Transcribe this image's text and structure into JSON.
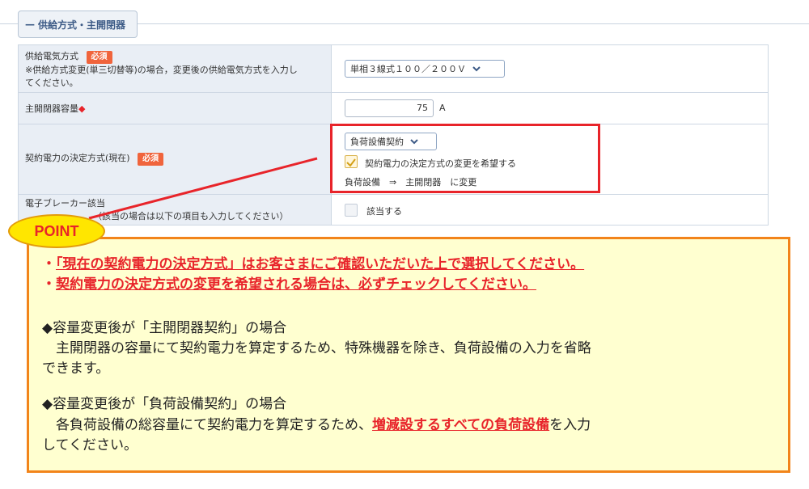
{
  "section": {
    "title": "供給方式・主開閉器"
  },
  "rows": {
    "supply": {
      "label": "供給電気方式",
      "required": "必須",
      "note": "※供給方式変更(単三切替等)の場合，変更後の供給電気方式を入力してください。",
      "select_value": "単相３線式１００／２００Ｖ"
    },
    "breaker": {
      "label": "主開閉器容量",
      "marker": "◆",
      "value": "75",
      "unit": "A"
    },
    "contract": {
      "label": "契約電力の決定方式(現在)",
      "required": "必須",
      "select_value": "負荷設備契約",
      "checkbox_label": "契約電力の決定方式の変更を希望する",
      "change_text": "負荷設備　⇒　主開閉器　に変更"
    },
    "ebreaker": {
      "label": "電子ブレーカー該当",
      "note": "（該当の場合は以下の項目も入力してください）",
      "checkbox_label": "該当する"
    }
  },
  "point": {
    "badge": "POINT",
    "line1_prefix": "・",
    "line1": "「現在の契約電力の決定方式」はお客さまにご確認いただいた上で選択してください。",
    "line2_prefix": "・",
    "line2": "契約電力の決定方式の変更を希望される場合は、必ずチェックしてください。",
    "case1_title": "◆容量変更後が「主開閉器契約」の場合",
    "case1_body1": "　主開閉器の容量にて契約電力を算定するため、特殊機器を除き、負荷設備の入力を省略",
    "case1_body2": "できます。",
    "case2_title": "◆容量変更後が「負荷設備契約」の場合",
    "case2_body1_a": "　各負荷設備の総容量にて契約電力を算定するため、",
    "case2_body1_b": "増減設するすべての負荷設備",
    "case2_body1_c": "を入力",
    "case2_body2": "してください。"
  },
  "colors": {
    "accent_red": "#e8242a",
    "point_bg": "#ffffd0",
    "point_border": "#f2841a",
    "badge_bg": "#ffe600"
  }
}
